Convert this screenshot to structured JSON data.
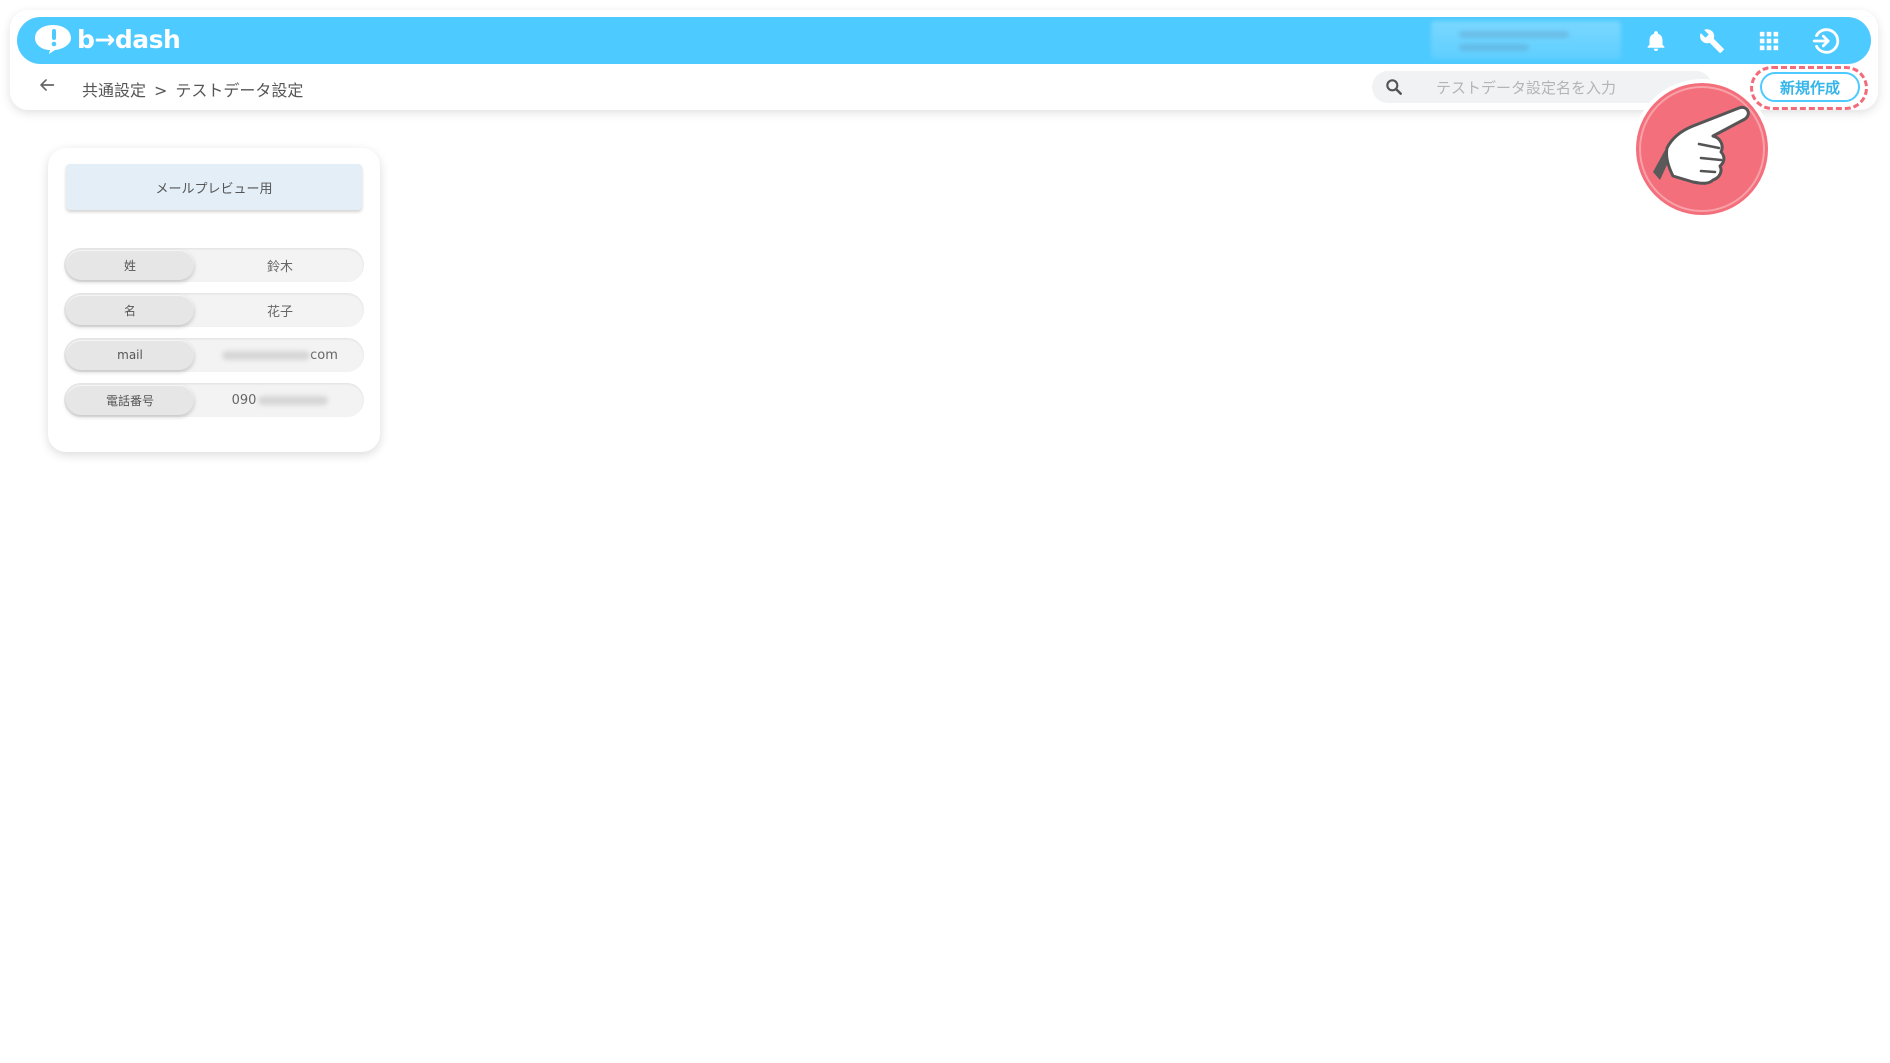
{
  "app": {
    "logo_text": "b→dash"
  },
  "header": {
    "icons": [
      "bell-icon",
      "wrench-icon",
      "apps-grid-icon",
      "logout-icon"
    ]
  },
  "breadcrumb": {
    "parent": "共通設定",
    "separator": ">",
    "current": "テストデータ設定"
  },
  "search": {
    "placeholder": "テストデータ設定名を入力"
  },
  "toolbar": {
    "new_label": "新規作成"
  },
  "card": {
    "title": "メールプレビュー用",
    "rows": [
      {
        "label": "姓",
        "value": "鈴木"
      },
      {
        "label": "名",
        "value": "花子"
      },
      {
        "label": "mail",
        "value_suffix": "com"
      },
      {
        "label": "電話番号",
        "value_prefix": "090"
      }
    ]
  },
  "colors": {
    "header_bg": "#4dcaff",
    "accent": "#36b6ea",
    "highlight": "#f26b7a"
  }
}
